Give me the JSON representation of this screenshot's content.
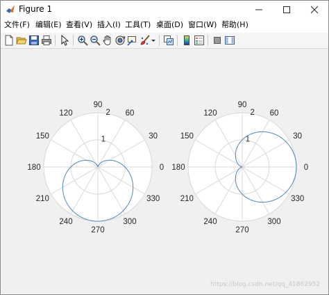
{
  "window": {
    "title": "Figure 1",
    "controls": [
      "minimize",
      "maximize",
      "close"
    ]
  },
  "menu": [
    "文件(F)",
    "编辑(E)",
    "查看(V)",
    "插入(I)",
    "工具(T)",
    "桌面(D)",
    "窗口(W)",
    "帮助(H)"
  ],
  "toolbar": {
    "icons": [
      "new-figure-icon",
      "open-file-icon",
      "save-icon",
      "print-icon",
      "edit-plot-arrow-icon",
      "zoom-in-icon",
      "zoom-out-icon",
      "pan-hand-icon",
      "rotate-3d-icon",
      "data-cursor-icon",
      "brush-icon",
      "brush-dropdown-icon",
      "link-plot-icon",
      "insert-colorbar-icon",
      "insert-legend-icon",
      "hide-plot-tools-icon",
      "show-plot-tools-icon"
    ]
  },
  "colors": {
    "curve": "#4d86c0",
    "grid": "#d8d8d8",
    "axis_bg": "#ffffff",
    "figure_bg": "#f0f0f0"
  },
  "chart_data": [
    {
      "type": "polar-line",
      "theta_ticks": [
        "0",
        "30",
        "60",
        "90",
        "120",
        "150",
        "180",
        "210",
        "240",
        "270",
        "300",
        "330"
      ],
      "r_ticks": [
        "1",
        "2"
      ],
      "rlim": [
        0,
        2
      ],
      "grid": true,
      "curve": "r = 1 - sin(theta)",
      "r_values_at_theta_ticks": [
        1.0,
        0.5,
        0.134,
        0.0,
        0.134,
        0.5,
        1.0,
        1.5,
        1.866,
        2.0,
        1.866,
        1.5
      ]
    },
    {
      "type": "polar-line",
      "theta_ticks": [
        "0",
        "30",
        "60",
        "90",
        "120",
        "150",
        "180",
        "210",
        "240",
        "270",
        "300",
        "330"
      ],
      "r_ticks": [
        "1",
        "2"
      ],
      "rlim": [
        0,
        2
      ],
      "grid": true,
      "curve": "r = 1 + cos(theta)",
      "r_values_at_theta_ticks": [
        2.0,
        1.866,
        1.5,
        1.0,
        0.5,
        0.134,
        0.0,
        0.134,
        0.5,
        1.0,
        1.5,
        1.866
      ]
    }
  ],
  "watermark": "https://blog.csdn.net/qq_41862952"
}
